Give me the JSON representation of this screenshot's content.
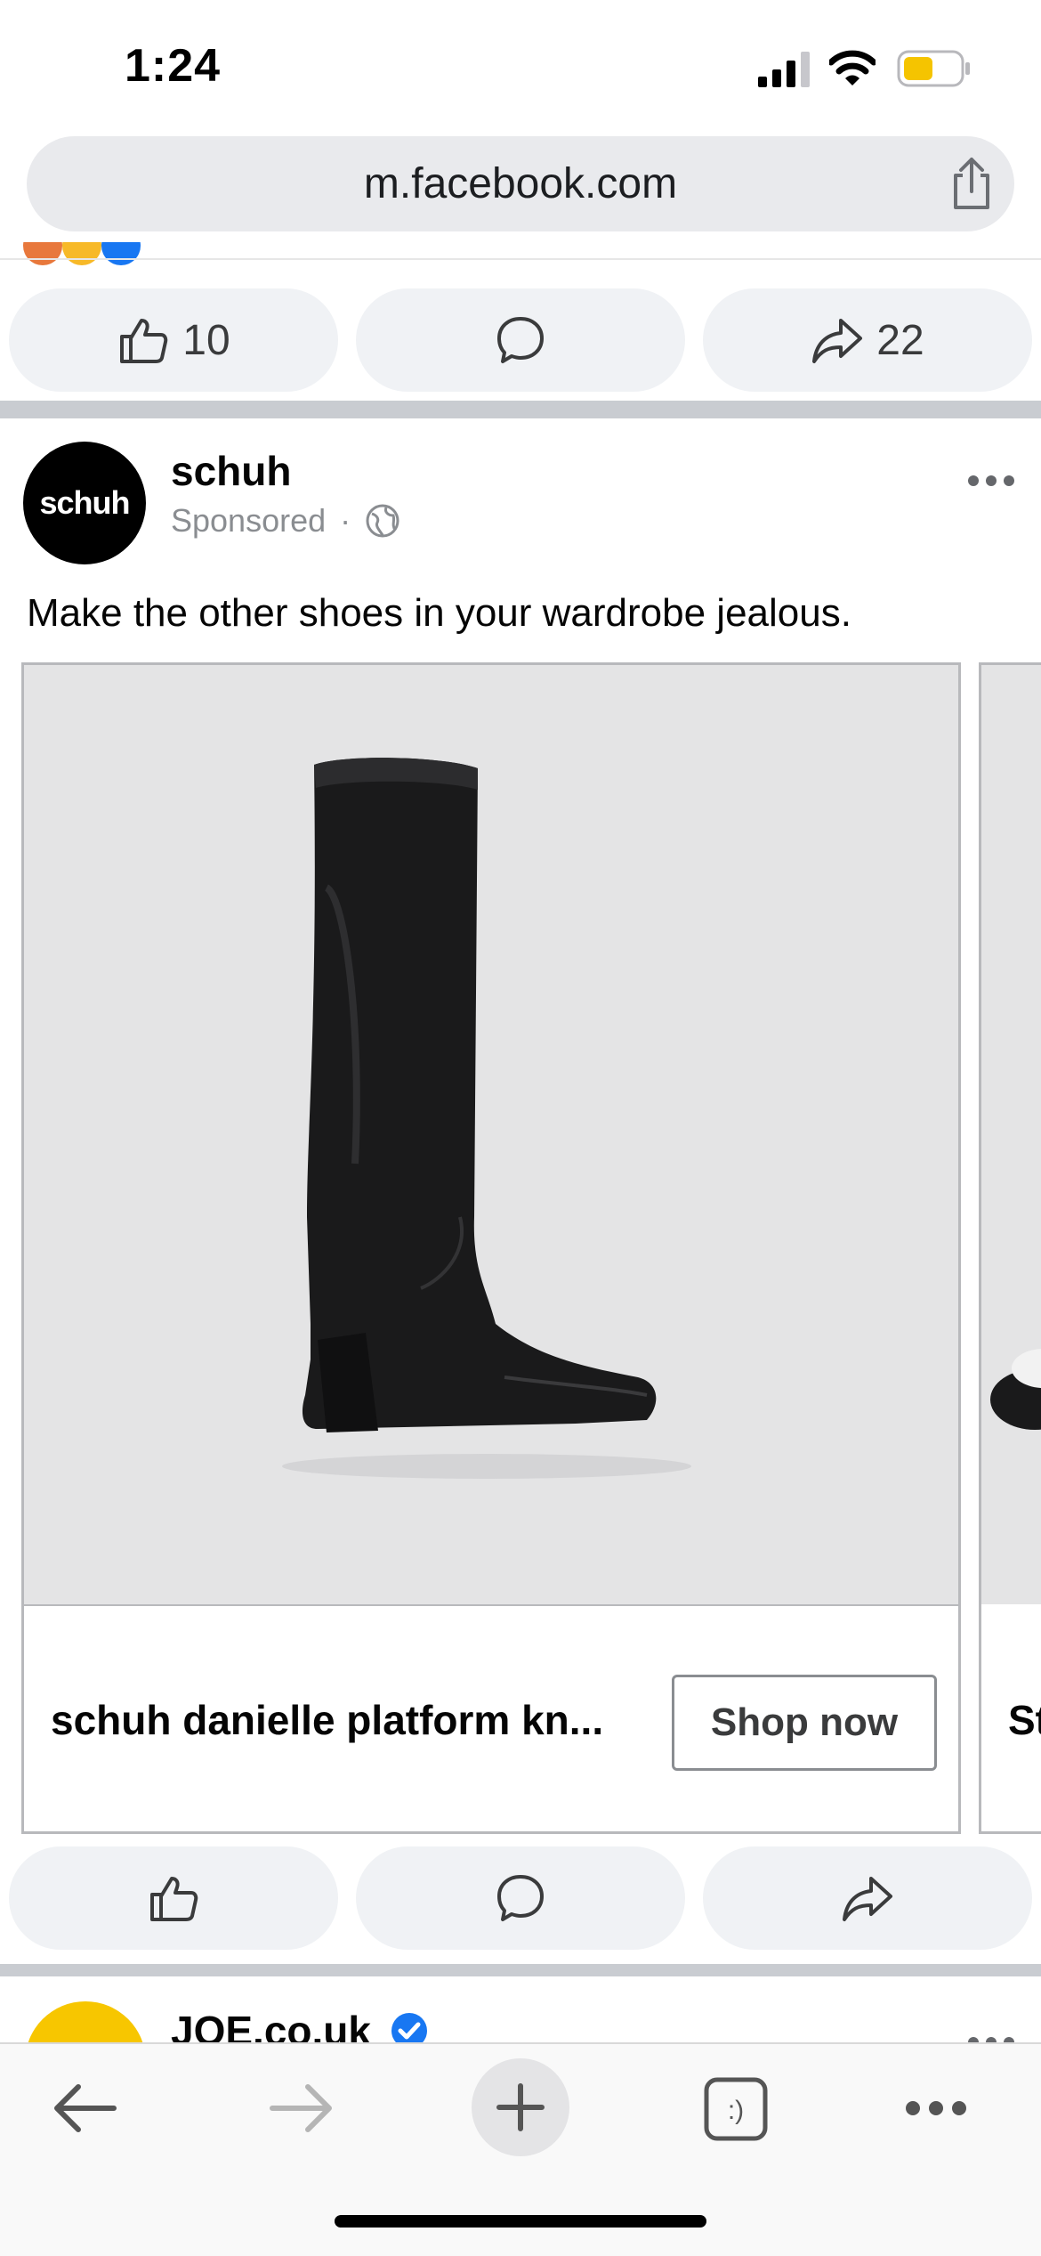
{
  "status_bar": {
    "time": "1:24",
    "battery_color": "#f5c400"
  },
  "browser": {
    "url": "m.facebook.com"
  },
  "previous_post": {
    "actions": {
      "like_count": "10",
      "share_count": "22"
    }
  },
  "post": {
    "page_name": "schuh",
    "avatar_text": "schuh",
    "sponsored_label": "Sponsored",
    "caption": "Make the other shoes in your wardrobe jealous.",
    "carousel": [
      {
        "title": "schuh danielle platform kn...",
        "cta": "Shop now"
      },
      {
        "title": "St"
      }
    ]
  },
  "next_post": {
    "page_name": "JOE.co.uk"
  },
  "colors": {
    "pill_bg": "#f0f2f5",
    "separator": "#c9ccd1",
    "verified": "#1877f2"
  },
  "icons": [
    "signal-icon",
    "wifi-icon",
    "battery-icon",
    "share-icon",
    "like-icon",
    "comment-icon",
    "share-arrow-icon",
    "globe-icon",
    "more-icon",
    "verified-icon",
    "back-icon",
    "forward-icon",
    "new-tab-icon",
    "tabs-icon",
    "menu-icon"
  ]
}
